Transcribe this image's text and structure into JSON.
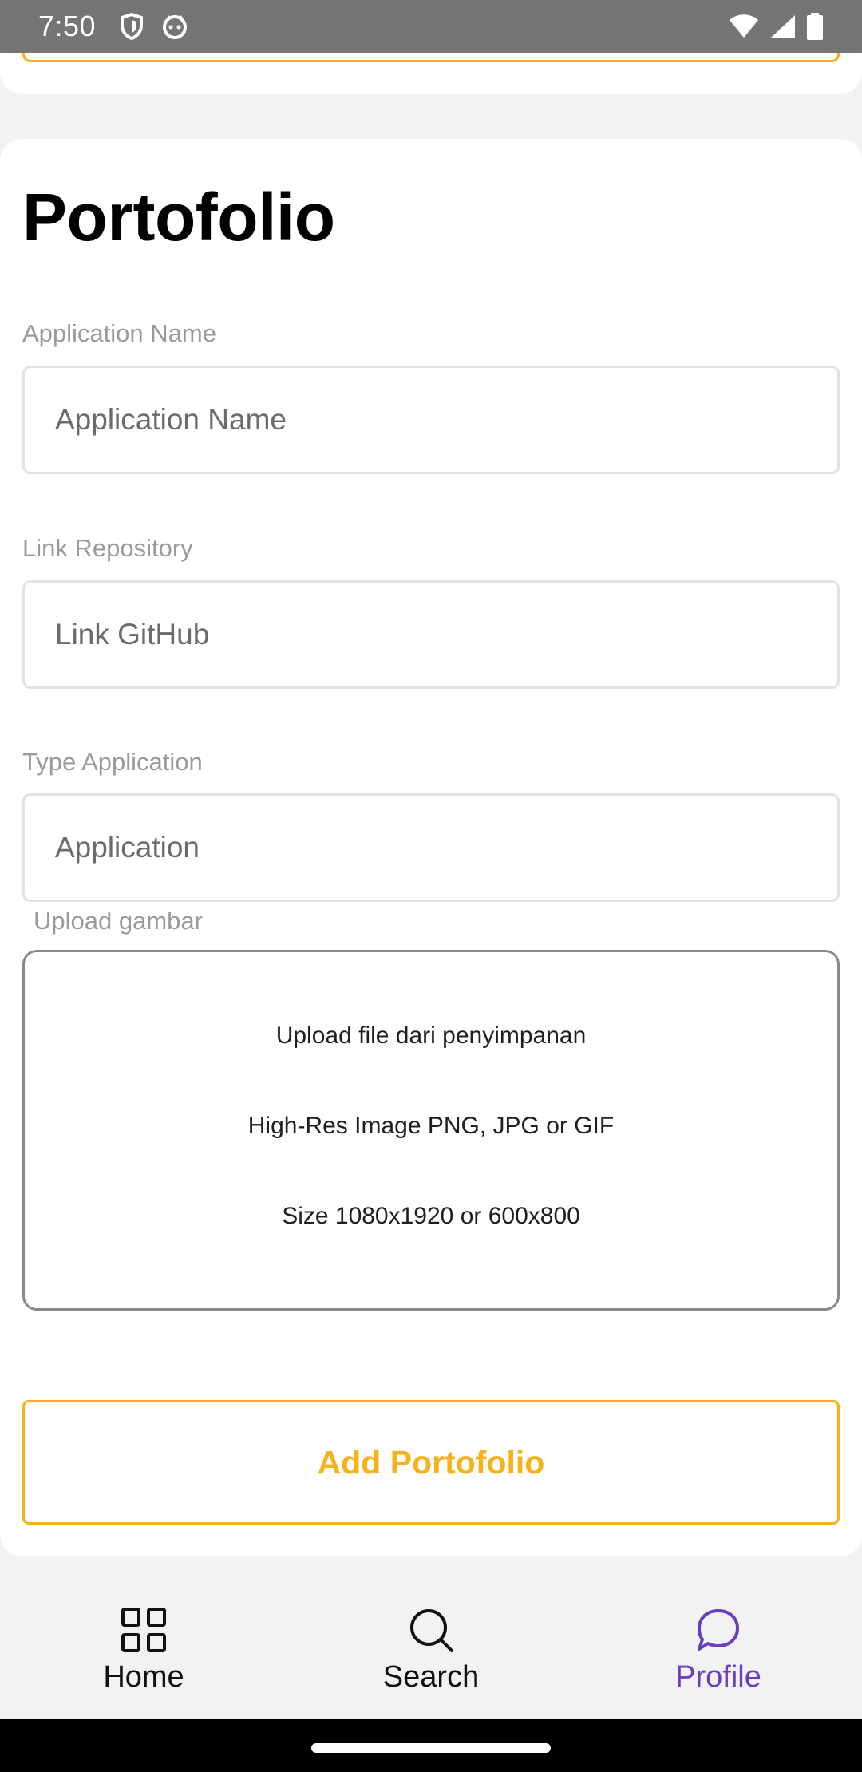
{
  "status_bar": {
    "time": "7:50",
    "left_icons": [
      "shield-icon",
      "cat-face-icon"
    ],
    "right_icons": [
      "wifi-icon",
      "signal-icon",
      "battery-icon"
    ]
  },
  "portfolio": {
    "title": "Portofolio",
    "fields": {
      "app_name": {
        "label": "Application Name",
        "placeholder": "Application Name",
        "value": ""
      },
      "repo_link": {
        "label": "Link Repository",
        "placeholder": "Link GitHub",
        "value": ""
      },
      "app_type": {
        "label": "Type Application",
        "placeholder": "Application",
        "value": ""
      }
    },
    "upload": {
      "label": "Upload gambar",
      "line1": "Upload file dari penyimpanan",
      "line2": "High-Res Image PNG, JPG or GIF",
      "line3": "Size 1080x1920 or 600x800"
    },
    "submit_label": "Add Portofolio"
  },
  "bottom_nav": {
    "items": [
      {
        "label": "Home",
        "icon": "grid-icon",
        "active": false
      },
      {
        "label": "Search",
        "icon": "search-icon",
        "active": false
      },
      {
        "label": "Profile",
        "icon": "chat-bubble-icon",
        "active": true
      }
    ]
  },
  "colors": {
    "accent": "#f5b21b",
    "active_nav": "#6a3fbf",
    "status_bar": "#757575"
  }
}
